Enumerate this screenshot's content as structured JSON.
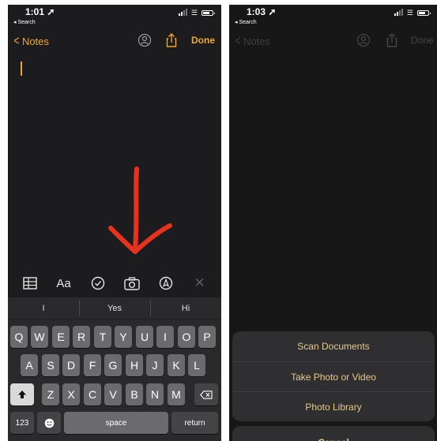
{
  "left": {
    "status": {
      "time": "1:01",
      "back_app": "Search"
    },
    "nav": {
      "back_label": "Notes",
      "done_label": "Done"
    },
    "toolbar": {
      "format_label": "Aa"
    },
    "suggestions": [
      "I",
      "Yes",
      "Hi"
    ],
    "keyboard": {
      "row1": [
        "Q",
        "W",
        "E",
        "R",
        "T",
        "Y",
        "U",
        "I",
        "O",
        "P"
      ],
      "row2": [
        "A",
        "S",
        "D",
        "F",
        "G",
        "H",
        "J",
        "K",
        "L"
      ],
      "row3": [
        "Z",
        "X",
        "C",
        "V",
        "B",
        "N",
        "M"
      ],
      "numbers_label": "123",
      "space_label": "space",
      "return_label": "return"
    }
  },
  "right": {
    "status": {
      "time": "1:03",
      "back_app": "Search"
    },
    "nav": {
      "back_label": "Notes",
      "done_label": "Done"
    },
    "sheet": {
      "options": [
        "Scan Documents",
        "Take Photo or Video",
        "Photo Library"
      ],
      "cancel_label": "Cancel"
    }
  },
  "colors": {
    "accent": "#f0a823",
    "sheet_text": "#e8c98c",
    "arrow": "#e8321e"
  }
}
